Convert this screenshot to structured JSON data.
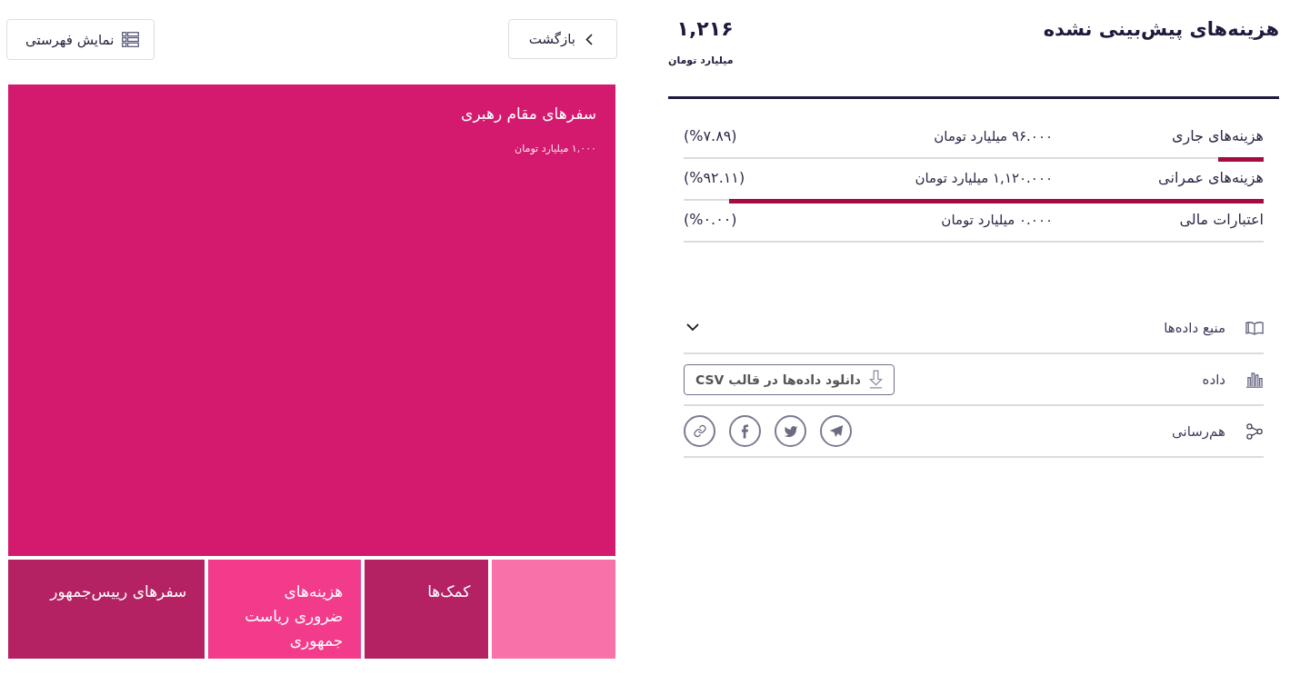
{
  "summary": {
    "title": "هزینه‌های پیش‌بینی نشده",
    "total": "۱,۲۱۶",
    "unit": "میلیارد تومان"
  },
  "breakdown": [
    {
      "label": "هزینه‌های جاری",
      "amount": "۹۶.۰۰۰ میلیارد تومان",
      "percent": "(%۷.۸۹)",
      "level": 0.0789
    },
    {
      "label": "هزینه‌های عمرانی",
      "amount": "۱,۱۲۰.۰۰۰ میلیارد تومان",
      "percent": "(%۹۲.۱۱)",
      "level": 0.9211
    },
    {
      "label": "اعتبارات مالی",
      "amount": "۰.۰۰۰ میلیارد تومان",
      "percent": "(%۰.۰۰)"
    }
  ],
  "sections": [
    {
      "kind": "source",
      "label": "منبع داده‌ها",
      "expanded": false
    },
    {
      "kind": "data",
      "label": "داده",
      "button": "دانلود داده‌ها در قالب CSV"
    },
    {
      "kind": "share",
      "label": "هم‌رسانی"
    }
  ],
  "toolbar": {
    "back_button": "بازگشت",
    "list_view_button": "نمایش فهرستی"
  },
  "treemap": {
    "tiles": [
      {
        "label": "سفرهای مقام رهبری",
        "value": "۱,۰۰۰ میلیارد تومان",
        "color": "#d31a6e"
      },
      {
        "color": "#f871a8"
      },
      {
        "label": "کمک‌ها",
        "color": "#b42263"
      },
      {
        "label": "هزینه‌های ضروری ریاست جمهوری",
        "color": "#f33b8c"
      },
      {
        "label": "سفرهای رییس‌جمهور",
        "color": "#b42263"
      }
    ]
  }
}
